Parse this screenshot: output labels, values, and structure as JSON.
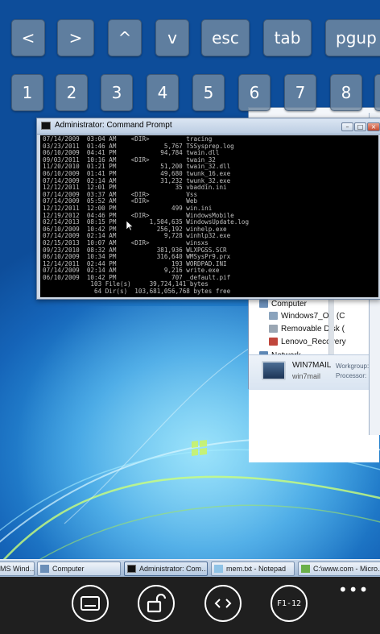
{
  "keyboard": {
    "row1": [
      "<",
      ">",
      "^",
      "v",
      "esc",
      "tab",
      "pgup"
    ],
    "row2": [
      "1",
      "2",
      "3",
      "4",
      "5",
      "6",
      "7",
      "8"
    ]
  },
  "cmd": {
    "title": "Administrator: Command Prompt",
    "lines": [
      "07/14/2009  03:04 AM    <DIR>          tracing",
      "03/23/2011  01:46 AM             5,767 TSSysprep.log",
      "06/10/2009  04:41 PM            94,784 twain.dll",
      "09/03/2011  10:16 AM    <DIR>          twain_32",
      "11/20/2010  01:21 PM            51,200 twain_32.dll",
      "06/10/2009  01:41 PM            49,680 twunk_16.exe",
      "07/14/2009  02:14 AM            31,232 twunk_32.exe",
      "12/12/2011  12:01 PM                35 vbaddin.ini",
      "07/14/2009  03:37 AM    <DIR>          Vss",
      "07/14/2009  05:52 AM    <DIR>          Web",
      "12/12/2011  12:00 PM               499 win.ini",
      "12/19/2012  04:46 PM    <DIR>          WindowsMobile",
      "02/14/2013  08:15 PM         1,504,635 WindowsUpdate.log",
      "06/10/2009  10:42 PM           256,192 winhelp.exe",
      "07/14/2009  02:14 AM             9,728 winhlp32.exe",
      "02/15/2013  10:07 AM    <DIR>          winsxs",
      "09/23/2010  08:32 AM           381,936 WLXPGSS.SCR",
      "06/10/2009  10:34 PM           316,640 WMSysPr9.prx",
      "12/14/2011  02:44 PM               193 WORDPAD.INI",
      "07/14/2009  02:14 AM             9,216 write.exe",
      "06/10/2009  10:42 PM               707 _default.pif",
      "             103 File(s)     39,724,141 bytes",
      "              64 Dir(s)  103,681,056,768 bytes free",
      "",
      "C:\\Windows>"
    ]
  },
  "explorer": {
    "items": [
      "Computer",
      "Windows7_OS (C",
      "Removable Disk (",
      "Lenovo_Recovery",
      "Network"
    ],
    "detail_name": "WIN7MAIL",
    "detail_workgroup_label": "Workgroup:",
    "detail_workgroup_value": "Wi",
    "detail_sub": "win7mail",
    "detail_processor_label": "Processor:",
    "detail_processor_value": "Pe"
  },
  "taskbar": {
    "items": [
      "MS Wind…",
      "Computer",
      "Administrator: Com…",
      "mem.txt - Notepad",
      "C:\\www.com - Micro…"
    ]
  },
  "appbar": {
    "buttons": [
      "keyboard-icon",
      "unlock-icon",
      "code-icon",
      "F1-12"
    ],
    "f_label": "F1-12",
    "more": "•••"
  },
  "colors": {
    "key_bg": "#6e87a0",
    "desktop": "#1b6fc2",
    "appbar": "#1f1f1f"
  }
}
